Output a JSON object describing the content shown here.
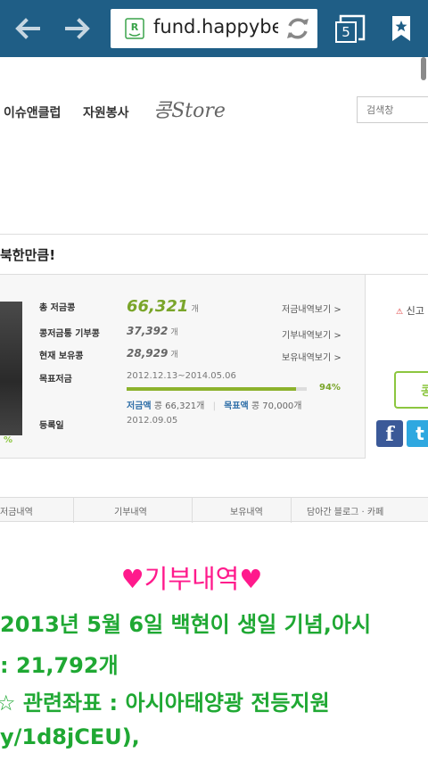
{
  "browser": {
    "url": "fund.happybea",
    "tab_count": "5"
  },
  "site_nav": {
    "items": [
      "이슈앤클럽",
      "자원봉사"
    ],
    "store_label": "콩Store",
    "search_placeholder": "검색창"
  },
  "fund": {
    "title": "북한만큼!",
    "stats": [
      {
        "label": "총 저금콩",
        "value": "66,321",
        "unit": "개",
        "link": "저금내역보기 >"
      },
      {
        "label": "콩저금통 기부콩",
        "value": "37,392",
        "unit": "개",
        "link": "기부내역보기 >"
      },
      {
        "label": "현재 보유콩",
        "value": "28,929",
        "unit": "개",
        "link": "보유내역보기 >"
      },
      {
        "label": "목표저금",
        "value": "",
        "unit": "",
        "link": ""
      },
      {
        "label": "등록일",
        "value": "",
        "unit": "",
        "link": ""
      }
    ],
    "period": "2012.12.13~2014.05.06",
    "progress_percent": 94,
    "progress_label": "94%",
    "saved_label": "저금액",
    "saved_amount": "콩 66,321개",
    "goal_label": "목표액",
    "goal_amount": "콩 70,000개",
    "registered_date": "2012.09.05",
    "photo_percent": "%"
  },
  "right_panel": {
    "report_label": "신고",
    "report_icon": "alert-icon",
    "action_label": "콩",
    "facebook": "f",
    "twitter": "t"
  },
  "subtabs": [
    "저금내역",
    "기부내역",
    "보유내역",
    "담아간 블로그 · 카페"
  ],
  "donation": {
    "heading": "♥기부내역♥",
    "lines": [
      "2013년 5월 6일 백현이 생일 기념,아시",
      ": 21,792개",
      "☆ 관련좌표 : 아시아태양광 전등지원",
      "y/1d8jCEU),"
    ]
  },
  "colors": {
    "browser_bar": "#1f5e86",
    "accent_green": "#8cc63f",
    "donation_pink": "#ff1a8c",
    "donation_green": "#1fa833"
  }
}
